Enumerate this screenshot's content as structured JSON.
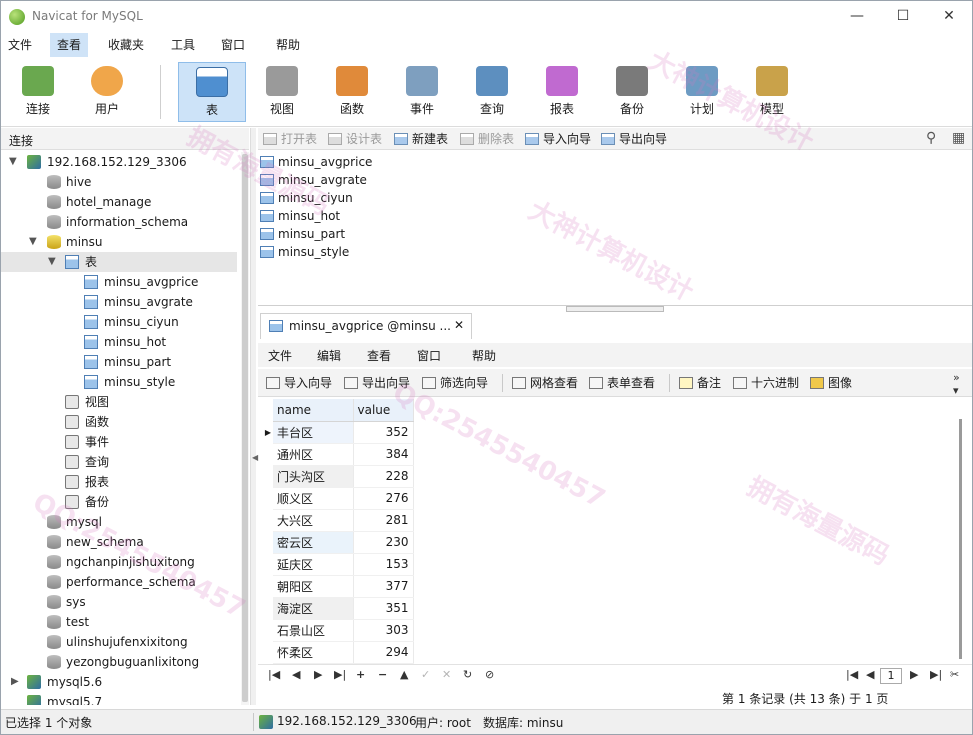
{
  "window": {
    "title": "Navicat for MySQL",
    "minimize": "—",
    "maximize": "☐",
    "close": "✕"
  },
  "menu": [
    "文件",
    "查看",
    "收藏夹",
    "工具",
    "窗口",
    "帮助"
  ],
  "toolbar": {
    "items": [
      {
        "label": "连接",
        "icon": "connection-icon",
        "color": "#6aa84f"
      },
      {
        "label": "用户",
        "icon": "user-icon",
        "color": "#f0a64a"
      },
      {
        "label": "表",
        "icon": "table-icon",
        "color": "#4f8fd0"
      },
      {
        "label": "视图",
        "icon": "view-icon",
        "color": "#8a8a8a"
      },
      {
        "label": "函数",
        "icon": "function-icon",
        "color": "#e08a3a"
      },
      {
        "label": "事件",
        "icon": "event-icon",
        "color": "#7e9fbf"
      },
      {
        "label": "查询",
        "icon": "query-icon",
        "color": "#5d8fbf"
      },
      {
        "label": "报表",
        "icon": "report-icon",
        "color": "#c06ad0"
      },
      {
        "label": "备份",
        "icon": "backup-icon",
        "color": "#7a7a7a"
      },
      {
        "label": "计划",
        "icon": "schedule-icon",
        "color": "#6d9bc3"
      },
      {
        "label": "模型",
        "icon": "model-icon",
        "color": "#c9a24a"
      }
    ],
    "active": "表"
  },
  "left": {
    "header": "连接",
    "connection": "192.168.152.129_3306",
    "databases_before": [
      "hive",
      "hotel_manage",
      "information_schema"
    ],
    "open_db": "minsu",
    "tables_node": "表",
    "tables": [
      "minsu_avgprice",
      "minsu_avgrate",
      "minsu_ciyun",
      "minsu_hot",
      "minsu_part",
      "minsu_style"
    ],
    "other_nodes": [
      "视图",
      "函数",
      "事件",
      "查询",
      "报表",
      "备份"
    ],
    "databases_after": [
      "mysql",
      "new_schema",
      "ngchanpinjishuxitong",
      "performance_schema",
      "sys",
      "test",
      "ulinshujufenxixitong",
      "yezongbuguanlixitong"
    ],
    "other_connections": [
      "mysql5.6",
      "mysql5.7"
    ]
  },
  "objbar": {
    "open": "打开表",
    "design": "设计表",
    "new": "新建表",
    "delete": "删除表",
    "import": "导入向导",
    "export": "导出向导"
  },
  "objects": [
    "minsu_avgprice",
    "minsu_avgrate",
    "minsu_ciyun",
    "minsu_hot",
    "minsu_part",
    "minsu_style"
  ],
  "tab": {
    "label": "minsu_avgprice @minsu ...",
    "close": "✕"
  },
  "inner_menu": [
    "文件",
    "编辑",
    "查看",
    "窗口",
    "帮助"
  ],
  "inner_toolbar": {
    "import": "导入向导",
    "export": "导出向导",
    "filter": "筛选向导",
    "grid": "网格查看",
    "form": "表单查看",
    "memo": "备注",
    "hex": "十六进制",
    "image": "图像"
  },
  "grid": {
    "columns": [
      "name",
      "value"
    ],
    "rows": [
      [
        "丰台区",
        "352"
      ],
      [
        "通州区",
        "384"
      ],
      [
        "门头沟区",
        "228"
      ],
      [
        "顺义区",
        "276"
      ],
      [
        "大兴区",
        "281"
      ],
      [
        "密云区",
        "230"
      ],
      [
        "延庆区",
        "153"
      ],
      [
        "朝阳区",
        "377"
      ],
      [
        "海淀区",
        "351"
      ],
      [
        "石景山区",
        "303"
      ],
      [
        "怀柔区",
        "294"
      ]
    ]
  },
  "nav": {
    "page": "1",
    "record_info": "第 1 条记录 (共 13 条) 于 1 页"
  },
  "status": {
    "selected": "已选择 1 个对象",
    "connection": "192.168.152.129_3306",
    "user": "用户: root",
    "database": "数据库: minsu"
  },
  "watermark": [
    "拥有海量源码",
    "大神计算机设计",
    "QQ:2545540457",
    "拥有海量源码",
    "大神计算机设计",
    "QQ:2545540457"
  ]
}
